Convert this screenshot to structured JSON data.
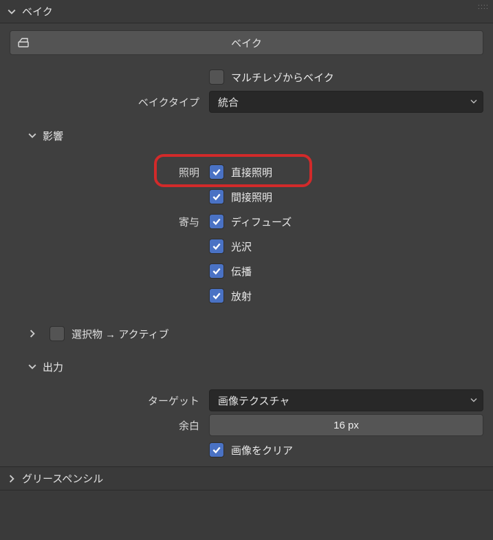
{
  "panel": {
    "title": "ベイク"
  },
  "bake_button": {
    "label": "ベイク"
  },
  "multires": {
    "label": "マルチレゾからベイク",
    "checked": false
  },
  "bake_type": {
    "label": "ベイクタイプ",
    "value": "統合"
  },
  "influence": {
    "title": "影響",
    "lighting_label": "照明",
    "direct": {
      "label": "直接照明",
      "checked": true
    },
    "indirect": {
      "label": "間接照明",
      "checked": true
    },
    "contrib_label": "寄与",
    "diffuse": {
      "label": "ディフューズ",
      "checked": true
    },
    "glossy": {
      "label": "光沢",
      "checked": true
    },
    "transmission": {
      "label": "伝播",
      "checked": true
    },
    "emit": {
      "label": "放射",
      "checked": true
    }
  },
  "selected_to_active": {
    "label": "選択物 → アクティブ",
    "checked": false
  },
  "output": {
    "title": "出力",
    "target_label": "ターゲット",
    "target_value": "画像テクスチャ",
    "margin_label": "余白",
    "margin_value": "16 px",
    "clear": {
      "label": "画像をクリア",
      "checked": true
    }
  },
  "grease_pencil": {
    "title": "グリースペンシル"
  }
}
